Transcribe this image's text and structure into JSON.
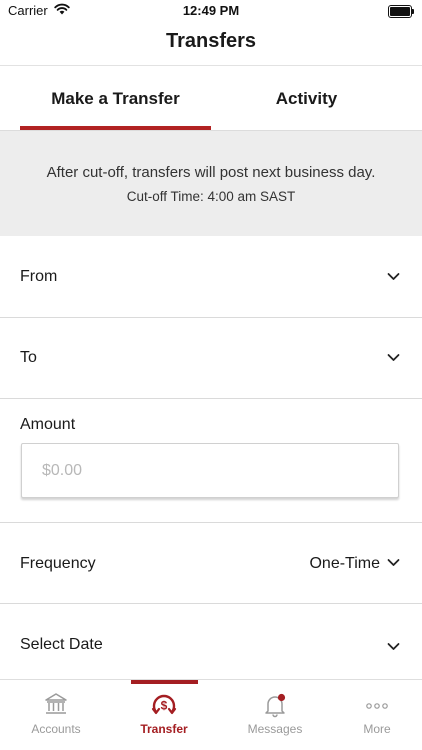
{
  "status_bar": {
    "carrier": "Carrier",
    "time": "12:49 PM"
  },
  "nav": {
    "title": "Transfers"
  },
  "tabs": [
    {
      "label": "Make a Transfer",
      "active": true
    },
    {
      "label": "Activity",
      "active": false
    }
  ],
  "banner": {
    "line1": "After cut-off, transfers will post next business day.",
    "line2": "Cut-off Time: 4:00 am SAST"
  },
  "form": {
    "from_label": "From",
    "to_label": "To",
    "amount_label": "Amount",
    "amount_placeholder": "$0.00",
    "frequency_label": "Frequency",
    "frequency_value": "One-Time",
    "date_label": "Select Date"
  },
  "tabbar": {
    "items": [
      {
        "label": "Accounts",
        "icon": "bank-icon",
        "active": false
      },
      {
        "label": "Transfer",
        "icon": "transfer-icon",
        "active": true
      },
      {
        "label": "Messages",
        "icon": "bell-icon",
        "active": false,
        "badge": true
      },
      {
        "label": "More",
        "icon": "more-icon",
        "active": false
      }
    ]
  },
  "colors": {
    "accent": "#a41e22",
    "banner_bg": "#ededed",
    "inactive": "#9a9a9a"
  }
}
